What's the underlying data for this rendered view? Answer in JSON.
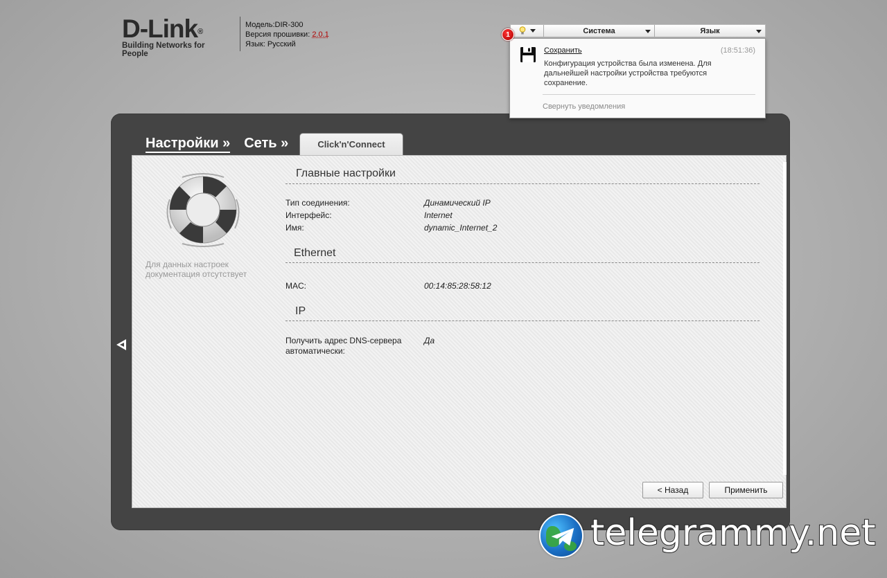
{
  "header": {
    "logo_main": "D-Link",
    "logo_sub": "Building Networks for People",
    "model_label": "Модель:",
    "model_value": "DIR-300",
    "firmware_label": "Версия прошивки: ",
    "firmware_value": "2.0.1",
    "language_label": "Язык: ",
    "language_value": "Русский"
  },
  "topmenu": {
    "notification_count": "1",
    "system_label": "Система",
    "language_label": "Язык"
  },
  "notification": {
    "title": "Сохранить",
    "time": "(18:51:36)",
    "text": "Конфигурация устройства была изменена. Для дальнейшей настройки устройства требуются сохранение.",
    "collapse_label": "Свернуть уведомления"
  },
  "breadcrumb": {
    "item1": "Настройки »",
    "item2": "Сеть »",
    "active_tab": "Click'n'Connect"
  },
  "help": {
    "text": "Для данных настроек документация отсутствует"
  },
  "sections": {
    "main": {
      "title": "Главные настройки",
      "rows": [
        {
          "label": "Тип соединения:",
          "value": "Динамический IP"
        },
        {
          "label": "Интерфейс:",
          "value": "Internet"
        },
        {
          "label": "Имя:",
          "value": "dynamic_Internet_2"
        }
      ]
    },
    "ethernet": {
      "title": "Ethernet",
      "rows": [
        {
          "label": "MAC:",
          "value": "00:14:85:28:58:12"
        }
      ]
    },
    "ip": {
      "title": "IP",
      "rows": [
        {
          "label": "Получить адрес DNS-сервера автоматически:",
          "value": "Да"
        }
      ]
    }
  },
  "buttons": {
    "back_label": "< Назад",
    "apply_label": "Применить"
  },
  "watermark": {
    "text": "telegrammy.net"
  },
  "colors": {
    "panel": "#444444",
    "badge": "#cc0000",
    "firmware_link": "#b10000"
  }
}
